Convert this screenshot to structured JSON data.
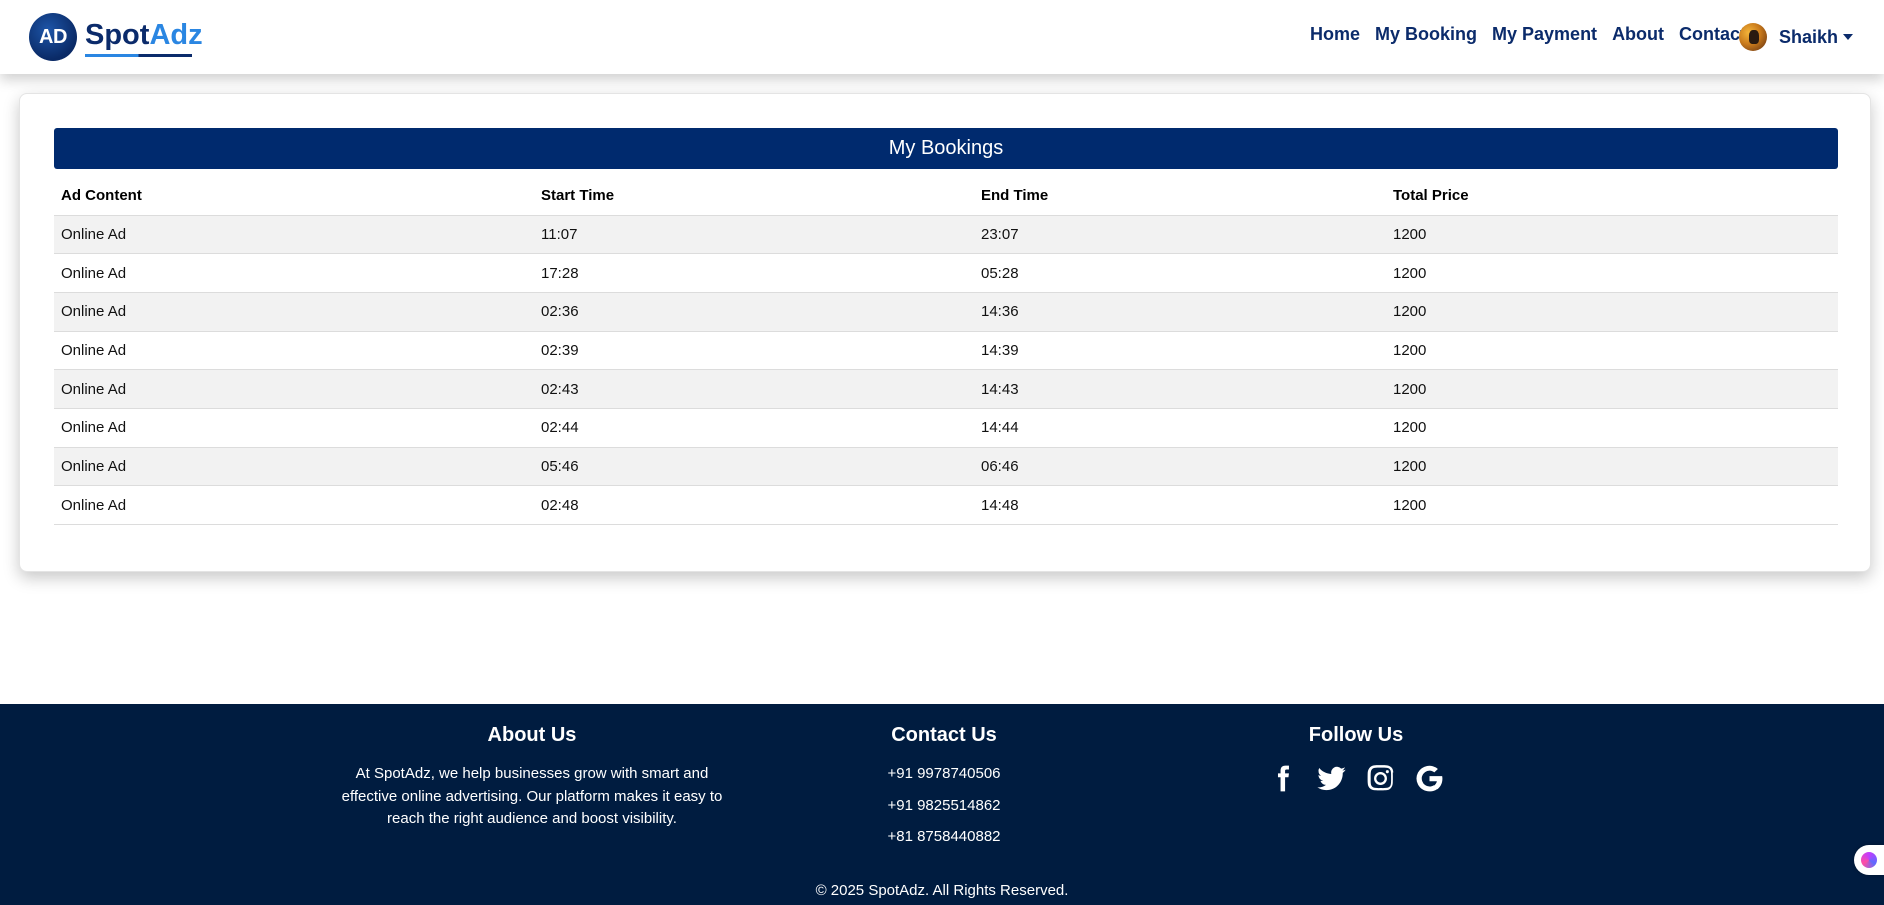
{
  "brand": {
    "badge": "AD",
    "name_part1": "Spot",
    "name_part2": "Adz"
  },
  "nav": {
    "links": [
      "Home",
      "My Booking",
      "My Payment",
      "About",
      "Contact"
    ],
    "user_name": "Shaikh"
  },
  "bookings": {
    "title": "My Bookings",
    "headers": [
      "Ad Content",
      "Start Time",
      "End Time",
      "Total Price"
    ],
    "rows": [
      [
        "Online Ad",
        "11:07",
        "23:07",
        "1200"
      ],
      [
        "Online Ad",
        "17:28",
        "05:28",
        "1200"
      ],
      [
        "Online Ad",
        "02:36",
        "14:36",
        "1200"
      ],
      [
        "Online Ad",
        "02:39",
        "14:39",
        "1200"
      ],
      [
        "Online Ad",
        "02:43",
        "14:43",
        "1200"
      ],
      [
        "Online Ad",
        "02:44",
        "14:44",
        "1200"
      ],
      [
        "Online Ad",
        "05:46",
        "06:46",
        "1200"
      ],
      [
        "Online Ad",
        "02:48",
        "14:48",
        "1200"
      ]
    ]
  },
  "footer": {
    "about_title": "About Us",
    "about_text": "At SpotAdz, we help businesses grow with smart and effective online advertising. Our platform makes it easy to reach the right audience and boost visibility.",
    "contact_title": "Contact Us",
    "phones": [
      "+91 9978740506",
      "+91 9825514862",
      "+81 8758440882"
    ],
    "follow_title": "Follow Us",
    "socials": [
      "facebook-icon",
      "twitter-icon",
      "instagram-icon",
      "google-icon"
    ],
    "copyright": "© 2025 SpotAdz. All Rights Reserved."
  },
  "colors": {
    "primary": "#002a6e",
    "footer": "#001c40",
    "accent": "#2a86e2"
  }
}
